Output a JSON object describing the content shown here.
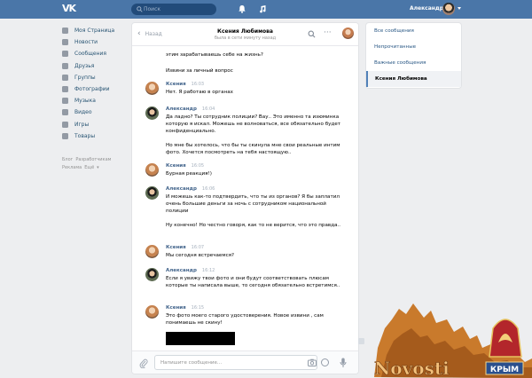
{
  "topbar": {
    "logo": "VK",
    "search_placeholder": "Поиск",
    "user_name": "Александр"
  },
  "leftnav": {
    "items": [
      {
        "label": "Моя Страница",
        "icon": "home-icon"
      },
      {
        "label": "Новости",
        "icon": "news-icon"
      },
      {
        "label": "Сообщения",
        "icon": "messages-icon"
      },
      {
        "label": "Друзья",
        "icon": "friends-icon"
      },
      {
        "label": "Группы",
        "icon": "groups-icon"
      },
      {
        "label": "Фотографии",
        "icon": "photos-icon"
      },
      {
        "label": "Музыка",
        "icon": "music-icon"
      },
      {
        "label": "Видео",
        "icon": "video-icon"
      },
      {
        "label": "Игры",
        "icon": "games-icon"
      },
      {
        "label": "Товары",
        "icon": "goods-icon"
      }
    ],
    "footer": [
      "Блог",
      "Разработчикам",
      "Реклама",
      "Ещё"
    ]
  },
  "chat": {
    "back_label": "Назад",
    "contact_name": "Ксения Любимова",
    "contact_status": "была в сети минуту назад",
    "composer_placeholder": "Напишите сообщение...",
    "messages": [
      {
        "type": "plain",
        "text": "этим зарабатываешь себе на жизнь?"
      },
      {
        "type": "plain",
        "text": "Извини за личный вопрос"
      },
      {
        "type": "msg",
        "author": "Ксения",
        "time": "16:03",
        "avatar": "k",
        "text": "Нет. Я работаю в органах"
      },
      {
        "type": "msg",
        "author": "Александр",
        "time": "16:04",
        "avatar": "a",
        "text": "Да ладно? Ты сотрудник полиции? Вау.. Это именно та изюминка которую я искал. Можешь не волноваться, все обязательно будет конфиденциально."
      },
      {
        "type": "plain",
        "text": "Но мне бы хотелось, что бы ты скинула мне свои реальные интим фото. Хочется посмотреть на тебя настоящую.."
      },
      {
        "type": "msg",
        "author": "Ксения",
        "time": "16:05",
        "avatar": "k",
        "text": "Бурная реакция!)"
      },
      {
        "type": "msg",
        "author": "Александр",
        "time": "16:06",
        "avatar": "a",
        "text": "И можешь как-то подтвердить, что ты из органов? Я бы заплатил очень большие деньги за ночь с сотрудником национальной полиции"
      },
      {
        "type": "plain",
        "text": "Ну конечно! Но честно говоря, как то не верится, что это правда.."
      },
      {
        "type": "msg",
        "author": "Ксения",
        "time": "16:07",
        "avatar": "k",
        "text": "Мы сегодня встречаемся?"
      },
      {
        "type": "msg",
        "author": "Александр",
        "time": "16:12",
        "avatar": "a",
        "text": "Если я увижу твои фото и они будут соответствовать плюсам которые ты написала выше, то сегодня обязательно встретимся.."
      },
      {
        "type": "msg",
        "author": "Ксения",
        "time": "16:15",
        "avatar": "k",
        "text": "Это фото моего старого удостоверения. Новое извини , сам понимаешь не скину!"
      }
    ]
  },
  "rightnav": {
    "items": [
      "Все сообщения",
      "Непрочитанные",
      "Важные сообщения"
    ],
    "active": "Ксения Любимова"
  },
  "watermark": {
    "text": "Novosti",
    "badge": "КРЫМ"
  },
  "colors": {
    "header": "#4a76a8",
    "link": "#2a5885",
    "author": "#42648b",
    "background": "#edeef0"
  }
}
